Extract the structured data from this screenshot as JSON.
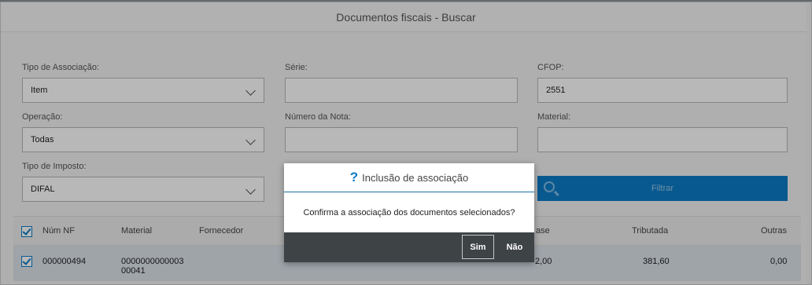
{
  "modal": {
    "title": "Documentos fiscais - Buscar"
  },
  "form": {
    "tipo_associacao": {
      "label": "Tipo de Associação:",
      "value": "Item"
    },
    "serie": {
      "label": "Série:",
      "value": ""
    },
    "cfop": {
      "label": "CFOP:",
      "value": "2551"
    },
    "operacao": {
      "label": "Operação:",
      "value": "Todas"
    },
    "numero_nota": {
      "label": "Número da Nota:",
      "value": ""
    },
    "material": {
      "label": "Material:",
      "value": ""
    },
    "tipo_imposto": {
      "label": "Tipo de Imposto:",
      "value": "DIFAL"
    },
    "filter_label": "Filtrar"
  },
  "table": {
    "headers": {
      "num_nf": "Núm NF",
      "material": "Material",
      "fornecedor": "Fornecedor",
      "base": "ase",
      "tributada": "Tributada",
      "outras": "Outras"
    },
    "rows": [
      {
        "num_nf": "000000494",
        "material_line1": "0000000000003",
        "material_line2": "00041",
        "base": "2,00",
        "tributada": "381,60",
        "outras": "0,00",
        "checked": true
      }
    ]
  },
  "dialog": {
    "title": "Inclusão de associação",
    "message": "Confirma a associação dos documentos selecionados?",
    "yes_label": "Sim",
    "no_label": "Não"
  },
  "colors": {
    "accent": "#0c7cc7",
    "dialog_footer": "#3e4346",
    "row_selected": "#dde3ea"
  },
  "icons": [
    "question-icon",
    "search-icon",
    "chevron-down-icon",
    "checkbox-checked-icon"
  ]
}
